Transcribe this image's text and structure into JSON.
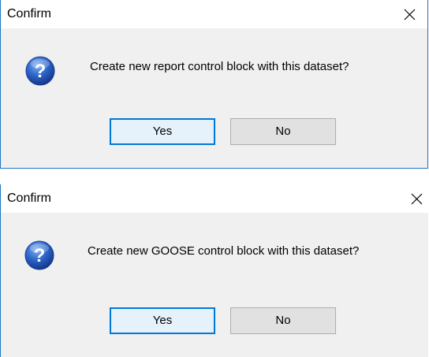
{
  "dialogs": [
    {
      "title": "Confirm",
      "message": "Create new report control block with this dataset?",
      "buttons": {
        "yes": "Yes",
        "no": "No"
      },
      "icon": "question-icon",
      "close_icon": "close-icon"
    },
    {
      "title": "Confirm",
      "message": "Create new GOOSE control block with this dataset?",
      "buttons": {
        "yes": "Yes",
        "no": "No"
      },
      "icon": "question-icon",
      "close_icon": "close-icon"
    }
  ],
  "colors": {
    "accent": "#0078d7",
    "window_border": "#1c73c8",
    "content_bg": "#f0f0f0",
    "button_bg": "#e1e1e1"
  }
}
